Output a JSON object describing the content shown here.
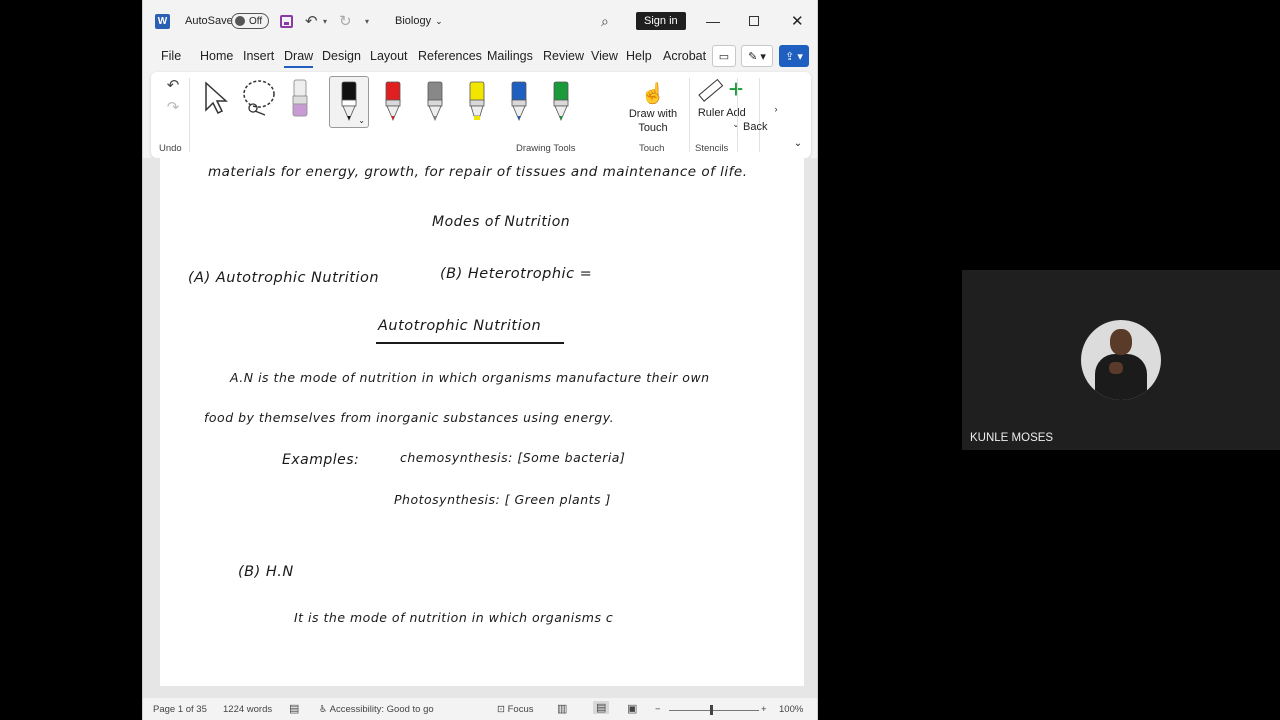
{
  "titlebar": {
    "autosave_label": "AutoSave",
    "autosave_state": "Off",
    "doc_title": "Biology",
    "signin_label": "Sign in"
  },
  "menu": [
    "File",
    "Home",
    "Insert",
    "Draw",
    "Design",
    "Layout",
    "References",
    "Mailings",
    "Review",
    "View",
    "Help",
    "Acrobat"
  ],
  "menu_active": "Draw",
  "ribbon": {
    "undo_group": "Undo",
    "drawing_tools_group": "Drawing Tools",
    "add_label": "Add",
    "draw_with_touch_label": "Draw with Touch",
    "touch_group": "Touch",
    "ruler_label": "Ruler",
    "stencils_group": "Stencils",
    "back_label": "Back",
    "pen_colors": [
      "#111111",
      "#e02020",
      "#888888",
      "#f2e600",
      "#1f5fbf",
      "#1a9a3a"
    ],
    "highlighter_color": "#c89ad6"
  },
  "document": {
    "line1": "materials for energy, growth, for repair of tissues and maintenance of life.",
    "heading1": "Modes of Nutrition",
    "mode_a": "(A) Autotrophic Nutrition",
    "mode_b": "(B) Heterotrophic =",
    "heading2": "Autotrophic Nutrition",
    "def1": "A.N is the mode of nutrition in which organisms manufacture their own",
    "def2": "food by themselves from inorganic substances using energy.",
    "examples_label": "Examples:",
    "example1": "chemosynthesis: [Some bacteria]",
    "example2": "Photosynthesis: [ Green plants ]",
    "hn_heading": "(B) H.N",
    "hn_def": "It is the mode of nutrition in which organisms c"
  },
  "status": {
    "page": "Page 1 of 35",
    "words": "1224 words",
    "accessibility": "Accessibility: Good to go",
    "focus": "Focus",
    "zoom": "100%"
  },
  "participant": {
    "name": "KUNLE MOSES"
  }
}
